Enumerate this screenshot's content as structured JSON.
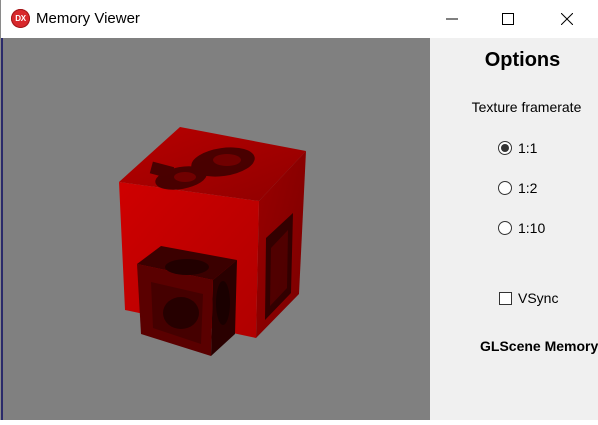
{
  "window": {
    "title": "Memory Viewer",
    "icon": "dx-app-icon",
    "controls": [
      "minimize-icon",
      "maximize-icon",
      "close-icon"
    ]
  },
  "viewport": {
    "background": "#808080",
    "scene": "rotating-textured-red-cube"
  },
  "options": {
    "title": "Options",
    "texture_framerate_label": "Texture framerate",
    "radios": [
      {
        "label": "1:1",
        "checked": true
      },
      {
        "label": "1:2",
        "checked": false
      },
      {
        "label": "1:10",
        "checked": false
      }
    ],
    "vsync": {
      "label": "VSync",
      "checked": false
    },
    "footer_label": "GLScene Memory"
  },
  "colors": {
    "cube_front": "#c10000",
    "cube_top": "#a30000",
    "cube_side": "#8b0000",
    "panel_bg": "#f0f0f0"
  }
}
